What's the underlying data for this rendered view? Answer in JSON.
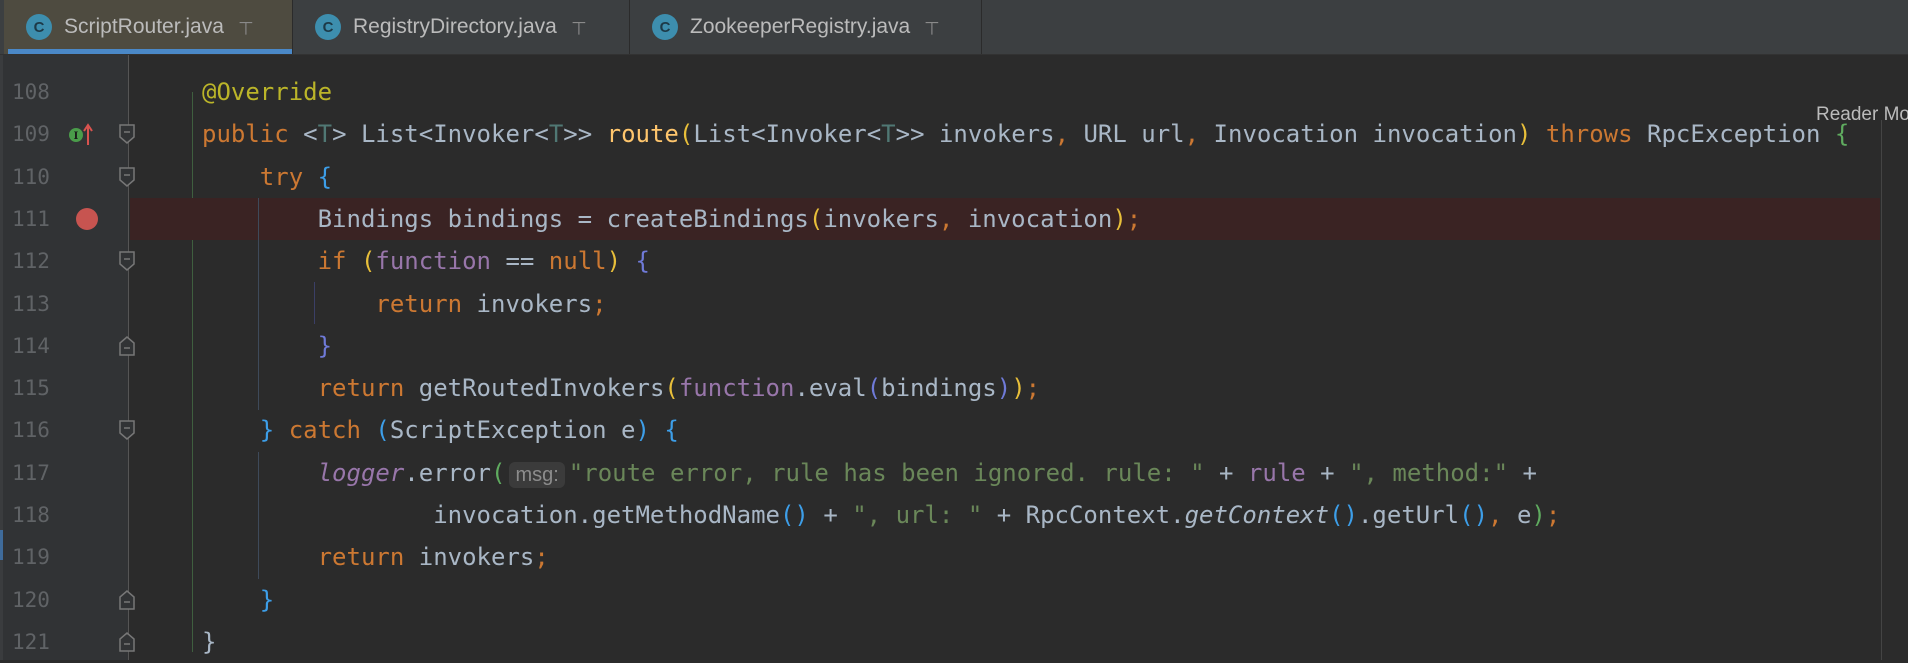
{
  "tabs": [
    {
      "label": "ScriptRouter.java",
      "icon": "class-icon",
      "icon_letter": "C",
      "pinned": true,
      "active": true
    },
    {
      "label": "RegistryDirectory.java",
      "icon": "class-icon",
      "icon_letter": "C",
      "pinned": true,
      "active": false
    },
    {
      "label": "ZookeeperRegistry.java",
      "icon": "class-icon",
      "icon_letter": "C",
      "pinned": true,
      "active": false
    }
  ],
  "reader_mode": "Reader Mo",
  "colors": {
    "background": "#2b2b2b",
    "keyword": "#cc7832",
    "string": "#6a8759",
    "field": "#9876aa",
    "breakpoint": "#c75450",
    "tab_accent": "#4a88c7"
  },
  "lines": [
    {
      "num": "108",
      "tokens": [
        [
          "a",
          "@Override"
        ]
      ]
    },
    {
      "num": "109",
      "marker": "implements-icon",
      "fold": "start",
      "tokens": [
        [
          "k",
          "public "
        ],
        [
          "",
          "<"
        ],
        [
          "tp",
          "T"
        ],
        [
          "",
          "> List<Invoker<"
        ],
        [
          "tp",
          "T"
        ],
        [
          "",
          ">> "
        ],
        [
          "m",
          "route"
        ],
        [
          "b3",
          "("
        ],
        [
          "",
          "List<Invoker<"
        ],
        [
          "tp",
          "T"
        ],
        [
          "",
          ">> invokers"
        ],
        [
          "k",
          ", "
        ],
        [
          "",
          "URL url"
        ],
        [
          "k",
          ", "
        ],
        [
          "",
          "Invocation invocation"
        ],
        [
          "b3",
          ")"
        ],
        [
          "k",
          " throws "
        ],
        [
          "",
          "RpcException "
        ],
        [
          "b1",
          "{"
        ]
      ]
    },
    {
      "num": "110",
      "fold": "start",
      "tokens": [
        [
          "",
          "    "
        ],
        [
          "k",
          "try "
        ],
        [
          "b2",
          "{"
        ]
      ]
    },
    {
      "num": "111",
      "breakpoint": true,
      "tokens": [
        [
          "",
          "        Bindings bindings = createBindings"
        ],
        [
          "b3",
          "("
        ],
        [
          "",
          "invokers"
        ],
        [
          "k",
          ", "
        ],
        [
          "",
          "invocation"
        ],
        [
          "b3",
          ")"
        ],
        [
          "k",
          ";"
        ]
      ]
    },
    {
      "num": "112",
      "fold": "start",
      "tokens": [
        [
          "",
          "        "
        ],
        [
          "k",
          "if "
        ],
        [
          "b3",
          "("
        ],
        [
          "f",
          "function"
        ],
        [
          "",
          " == "
        ],
        [
          "k",
          "null"
        ],
        [
          "b3",
          ")"
        ],
        [
          "",
          " "
        ],
        [
          "b4",
          "{"
        ]
      ]
    },
    {
      "num": "113",
      "tokens": [
        [
          "",
          "            "
        ],
        [
          "k",
          "return "
        ],
        [
          "",
          "invokers"
        ],
        [
          "k",
          ";"
        ]
      ]
    },
    {
      "num": "114",
      "fold": "end",
      "tokens": [
        [
          "",
          "        "
        ],
        [
          "b4",
          "}"
        ]
      ]
    },
    {
      "num": "115",
      "tokens": [
        [
          "",
          "        "
        ],
        [
          "k",
          "return "
        ],
        [
          "",
          "getRoutedInvokers"
        ],
        [
          "b3",
          "("
        ],
        [
          "f",
          "function"
        ],
        [
          "",
          ".eval"
        ],
        [
          "b4",
          "("
        ],
        [
          "",
          "bindings"
        ],
        [
          "b4",
          ")"
        ],
        [
          "b3",
          ")"
        ],
        [
          "k",
          ";"
        ]
      ]
    },
    {
      "num": "116",
      "fold": "start",
      "tokens": [
        [
          "",
          "    "
        ],
        [
          "b2",
          "}"
        ],
        [
          "k",
          " catch "
        ],
        [
          "b2",
          "("
        ],
        [
          "",
          "ScriptException e"
        ],
        [
          "b2",
          ")"
        ],
        [
          "",
          " "
        ],
        [
          "b2",
          "{"
        ]
      ]
    },
    {
      "num": "117",
      "tokens": [
        [
          "",
          "        "
        ],
        [
          "fi",
          "logger"
        ],
        [
          "",
          ".error"
        ],
        [
          "b1",
          "("
        ],
        [
          "hint",
          "msg:"
        ],
        [
          "s",
          "\"route error, rule has been ignored. rule: \""
        ],
        [
          "",
          " + "
        ],
        [
          "f",
          "rule"
        ],
        [
          "",
          " + "
        ],
        [
          "s",
          "\", method:\""
        ],
        [
          "",
          " +"
        ]
      ]
    },
    {
      "num": "118",
      "tokens": [
        [
          "",
          "                invocation.getMethodName"
        ],
        [
          "b2",
          "()"
        ],
        [
          "",
          " + "
        ],
        [
          "s",
          "\", url: \""
        ],
        [
          "",
          " + RpcContext."
        ],
        [
          "i",
          "getContext"
        ],
        [
          "b2",
          "()"
        ],
        [
          "",
          ".getUrl"
        ],
        [
          "b2",
          "()"
        ],
        [
          "k",
          ", "
        ],
        [
          "",
          "e"
        ],
        [
          "b1",
          ")"
        ],
        [
          "k",
          ";"
        ]
      ]
    },
    {
      "num": "119",
      "tokens": [
        [
          "",
          "        "
        ],
        [
          "k",
          "return "
        ],
        [
          "",
          "invokers"
        ],
        [
          "k",
          ";"
        ]
      ]
    },
    {
      "num": "120",
      "fold": "end",
      "tokens": [
        [
          "",
          "    "
        ],
        [
          "b2",
          "}"
        ]
      ]
    },
    {
      "num": "121",
      "fold": "end",
      "tokens": [
        [
          "",
          "}"
        ]
      ]
    }
  ]
}
